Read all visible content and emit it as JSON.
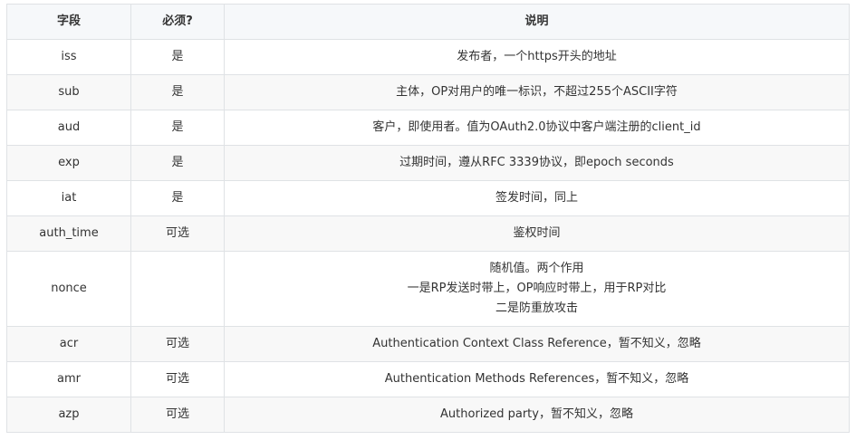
{
  "table": {
    "headers": [
      "字段",
      "必须?",
      "说明"
    ],
    "rows": [
      {
        "field": "iss",
        "required": "是",
        "desc": [
          "发布者，一个https开头的地址"
        ]
      },
      {
        "field": "sub",
        "required": "是",
        "desc": [
          "主体，OP对用户的唯一标识，不超过255个ASCII字符"
        ]
      },
      {
        "field": "aud",
        "required": "是",
        "desc": [
          "客户，即使用者。值为OAuth2.0协议中客户端注册的client_id"
        ]
      },
      {
        "field": "exp",
        "required": "是",
        "desc": [
          "过期时间，遵从RFC 3339协议，即epoch seconds"
        ]
      },
      {
        "field": "iat",
        "required": "是",
        "desc": [
          "签发时间，同上"
        ]
      },
      {
        "field": "auth_time",
        "required": "可选",
        "desc": [
          "鉴权时间"
        ]
      },
      {
        "field": "nonce",
        "required": "",
        "desc": [
          "随机值。两个作用",
          "一是RP发送时带上，OP响应时带上，用于RP对比",
          "二是防重放攻击"
        ]
      },
      {
        "field": "acr",
        "required": "可选",
        "desc": [
          "Authentication Context Class Reference，暂不知义，忽略"
        ]
      },
      {
        "field": "amr",
        "required": "可选",
        "desc": [
          "Authentication Methods References，暂不知义，忽略"
        ]
      },
      {
        "field": "azp",
        "required": "可选",
        "desc": [
          "Authorized party，暂不知义，忽略"
        ]
      }
    ]
  }
}
